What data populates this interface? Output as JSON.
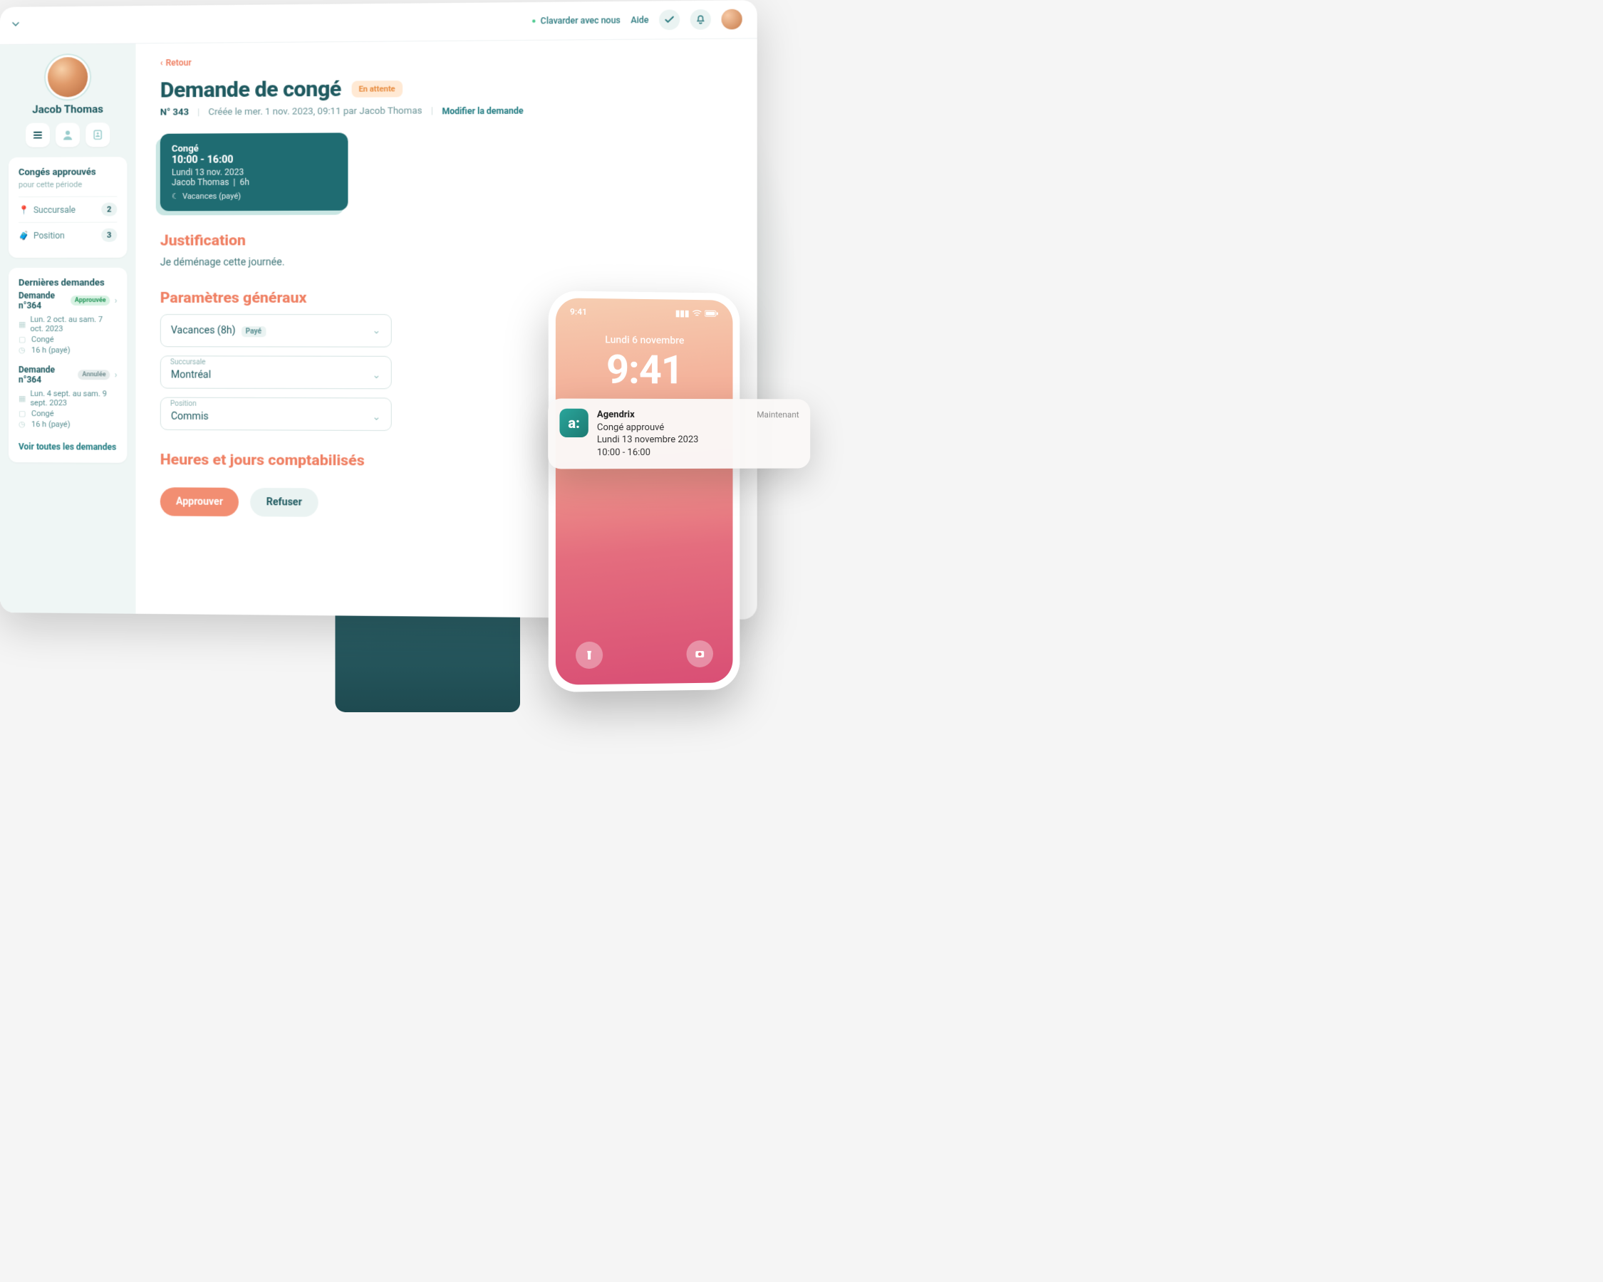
{
  "header": {
    "chat": "Clavarder avec nous",
    "help": "Aide"
  },
  "sidebar": {
    "user_name": "Jacob Thomas",
    "approved": {
      "title": "Congés approuvés",
      "subtitle": "pour cette période",
      "rows": [
        {
          "label": "Succursale",
          "count": "2"
        },
        {
          "label": "Position",
          "count": "3"
        }
      ]
    },
    "recent": {
      "title": "Dernières demandes",
      "items": [
        {
          "title": "Demande n°364",
          "status": "Approuvée",
          "status_kind": "green",
          "lines": [
            "Lun. 2 oct. au sam. 7 oct. 2023",
            "Congé",
            "16 h (payé)"
          ]
        },
        {
          "title": "Demande n°364",
          "status": "Annulée",
          "status_kind": "grey",
          "lines": [
            "Lun. 4 sept. au sam. 9 sept. 2023",
            "Congé",
            "16 h (payé)"
          ]
        }
      ],
      "see_all": "Voir toutes les demandes"
    }
  },
  "main": {
    "back": "Retour",
    "title": "Demande de congé",
    "status": "En attente",
    "ref": "N° 343",
    "created": "Créée le mer. 1 nov. 2023, 09:11 par Jacob Thomas",
    "edit": "Modifier la demande",
    "leave_card": {
      "type": "Congé",
      "time": "10:00 - 16:00",
      "date": "Lundi 13 nov. 2023",
      "who": "Jacob Thomas",
      "hours": "6h",
      "tag": "Vacances (payé)"
    },
    "justification": {
      "heading": "Justification",
      "text": "Je déménage cette journée."
    },
    "params": {
      "heading": "Paramètres généraux",
      "type_value": "Vacances (8h)",
      "type_badge": "Payé",
      "branch_label": "Succursale",
      "branch_value": "Montréal",
      "position_label": "Position",
      "position_value": "Commis"
    },
    "hours_heading": "Heures et jours comptabilisés",
    "approve": "Approuver",
    "reject": "Refuser"
  },
  "phone": {
    "status_time": "9:41",
    "lock_date": "Lundi 6 novembre",
    "lock_time": "9:41"
  },
  "notification": {
    "app": "Agendrix",
    "when": "Maintenant",
    "line1": "Congé approuvé",
    "line2": "Lundi 13 novembre 2023",
    "line3": "10:00 - 16:00"
  }
}
